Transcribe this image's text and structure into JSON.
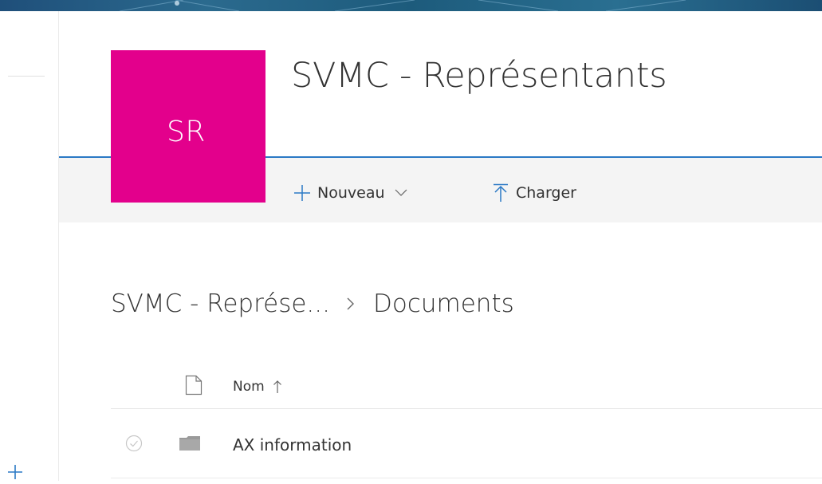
{
  "site": {
    "logo_initials": "SR",
    "logo_color": "#e3008c",
    "title": "SVMC - Représentants",
    "accent_color": "#2b79c5"
  },
  "commandbar": {
    "new_label": "Nouveau",
    "upload_label": "Charger",
    "icons": {
      "new": "plus-icon",
      "new_menu": "chevron-down-icon",
      "upload": "upload-icon"
    }
  },
  "breadcrumb": {
    "items": [
      "SVMC - Représe...",
      "Documents"
    ],
    "separator_icon": "chevron-right-icon"
  },
  "list": {
    "columns": [
      {
        "label": "Nom",
        "sort_icon": "sort-ascending-icon"
      }
    ],
    "file_type_icon": "document-icon",
    "rows": [
      {
        "name": "AX information",
        "type_icon": "folder-icon",
        "select_icon": "check-circle-icon"
      }
    ]
  },
  "rail": {
    "add_icon": "plus-icon"
  }
}
